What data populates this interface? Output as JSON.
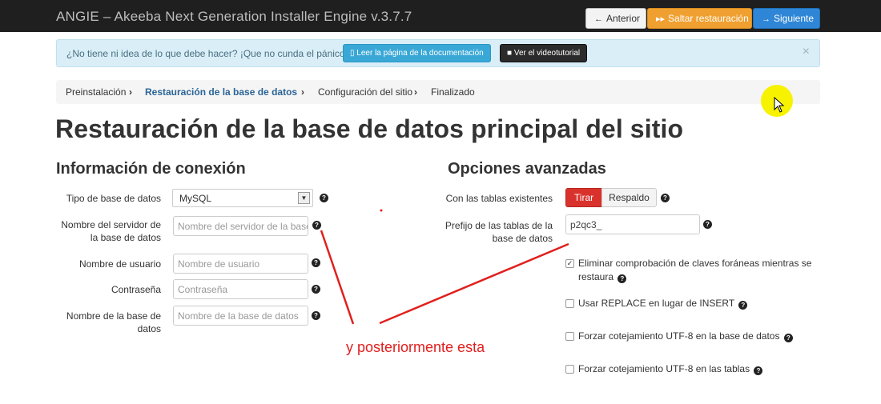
{
  "header": {
    "title": "ANGIE – Akeeba Next Generation Installer Engine v.3.7.7",
    "prev_label": "Anterior",
    "skip_label": "Saltar restauración",
    "next_label": "Siguiente"
  },
  "alert": {
    "text": "¿No tiene ni idea de lo que debe hacer? ¡Que no cunda el pánico!",
    "doc_button": "Leer la página de la documentación",
    "video_button": "Ver el videotutorial",
    "close": "×"
  },
  "breadcrumb": {
    "items": [
      "Preinstalación",
      "Restauración de la base de datos",
      "Configuración del sitio",
      "Finalizado"
    ],
    "separator": "›"
  },
  "page_title": "Restauración de la base de datos principal del sitio",
  "connection": {
    "title": "Información de conexión",
    "db_type_label": "Tipo de base de datos",
    "db_type_value": "MySQL",
    "host_label_1": "Nombre del servidor de",
    "host_label_2": "la base de datos",
    "host_placeholder": "Nombre del servidor de la base de datos",
    "user_label": "Nombre de usuario",
    "user_placeholder": "Nombre de usuario",
    "pass_label": "Contraseña",
    "pass_placeholder": "Contraseña",
    "dbname_label_1": "Nombre de la base de",
    "dbname_label_2": "datos",
    "dbname_placeholder": "Nombre de la base de datos"
  },
  "advanced": {
    "title": "Opciones avanzadas",
    "existing_label": "Con las tablas existentes",
    "drop_label": "Tirar",
    "backup_label": "Respaldo",
    "prefix_label_1": "Prefijo de las tablas de la",
    "prefix_label_2": "base de datos",
    "prefix_value": "p2qc3_",
    "fk_label_1": "Eliminar comprobación de claves foráneas mientras se",
    "fk_label_2": "restaura",
    "fk_checked": true,
    "replace_label": "Usar REPLACE en lugar de INSERT",
    "utf8_db_label": "Forzar cotejamiento UTF-8 en la base de datos",
    "utf8_tables_label": "Forzar cotejamiento UTF-8 en las tablas"
  },
  "annotation": {
    "text": "y posteriormente esta",
    "color": "#e0201e"
  },
  "colors": {
    "topbar": "#1f1f1f",
    "skip": "#f0a030",
    "next": "#2f86d6",
    "drop": "#d9322c",
    "breadcrumb_active": "#2a6496"
  }
}
